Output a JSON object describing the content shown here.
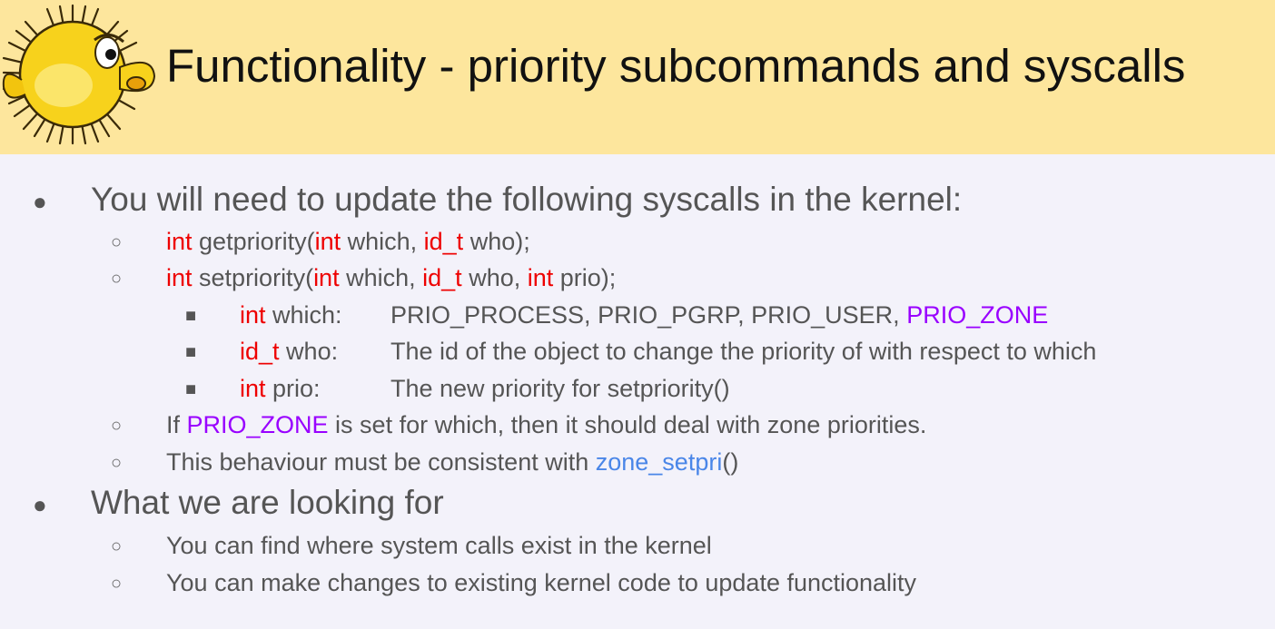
{
  "slide": {
    "title": "Functionality - priority subcommands and syscalls",
    "bullets": {
      "b1": "You will need to update the following syscalls in the kernel:",
      "getpriority": {
        "t1": "int",
        "t2": " getpriority(",
        "t3": "int",
        "t4": " which, ",
        "t5": "id_t",
        "t6": " who);"
      },
      "setpriority": {
        "t1": "int",
        "t2": " setpriority(",
        "t3": "int",
        "t4": " which, ",
        "t5": "id_t",
        "t6": " who, ",
        "t7": "int",
        "t8": " prio);"
      },
      "param_which": {
        "type": "int",
        "name": " which:",
        "desc": "PRIO_PROCESS, PRIO_PGRP, PRIO_USER, ",
        "highlight": "PRIO_ZONE"
      },
      "param_who": {
        "type": "id_t",
        "name": " who:",
        "desc": "The id of the object to change the priority of with respect to which"
      },
      "param_prio": {
        "type": "int",
        "name": " prio:",
        "desc": "The new priority for setpriority()"
      },
      "prio_zone_note": {
        "t1": "If ",
        "t2": "PRIO_ZONE",
        "t3": " is set for which, then it should deal with zone priorities."
      },
      "consistency": {
        "t1": "This behaviour must be consistent with ",
        "t2": "zone_setpri",
        "t3": "()"
      },
      "b2": "What we are looking for",
      "look1": "You can find where system calls exist in the kernel",
      "look2": "You can make changes to existing kernel code to update functionality"
    },
    "markers": {
      "level1": "●",
      "level2": "○",
      "level3": "■"
    },
    "colors": {
      "header_bg": "#fde69d",
      "body_bg": "#f3f2fa",
      "keyword_red": "#ee0000",
      "constant_purple": "#9900ff",
      "function_blue": "#4a86e8",
      "text_gray": "#555555"
    },
    "logo_icon": "pufferfish-mascot-icon"
  }
}
